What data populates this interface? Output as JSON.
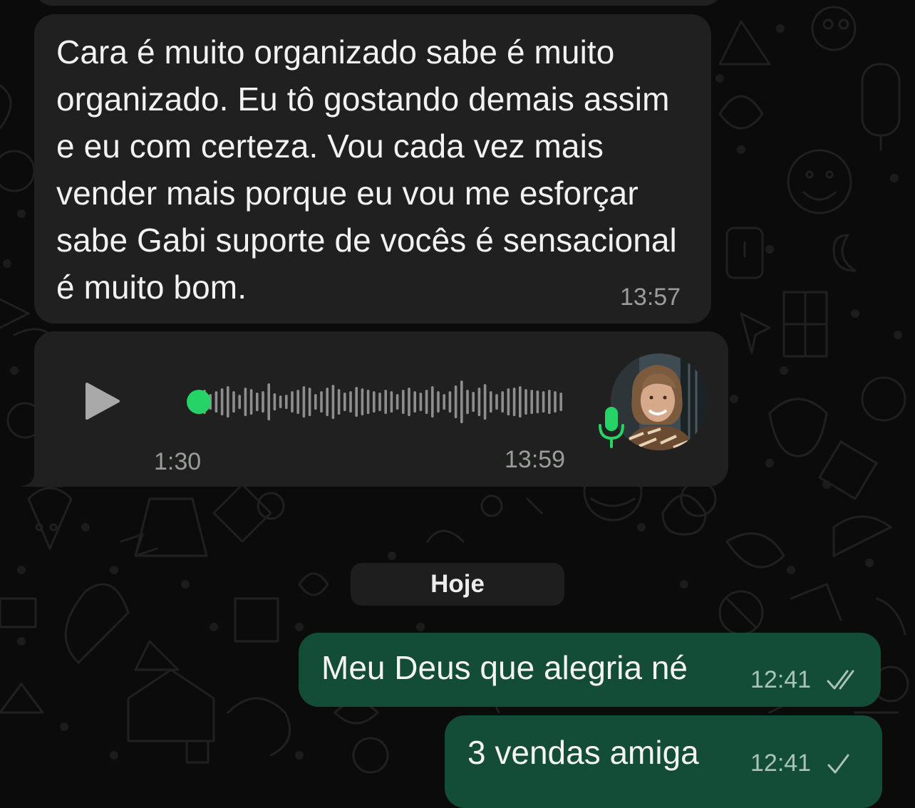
{
  "messages": {
    "incoming_text": "Cara é muito organizado sabe é muito organizado. Eu tô gostando demais assim e eu com certeza. Vou cada vez mais vender mais porque eu vou me esforçar sabe Gabi suporte de vocês é sensacional é muito bom.",
    "incoming_time": "13:57",
    "voice": {
      "duration": "1:30",
      "time": "13:59",
      "progress": 0,
      "play_icon": "play-icon",
      "mic_icon": "microphone-icon"
    },
    "date_separator": "Hoje",
    "outgoing": [
      {
        "text": "Meu Deus que alegria né",
        "time": "12:41",
        "status_icon": "double-check-icon"
      },
      {
        "text": "3 vendas amiga",
        "time": "12:41",
        "status_icon": "check-icon"
      }
    ]
  },
  "colors": {
    "background": "#0b0b0b",
    "incoming_bubble": "#1f201f",
    "outgoing_bubble": "#144d37",
    "accent_green": "#25d366",
    "meta_text": "#9b9d9b"
  }
}
